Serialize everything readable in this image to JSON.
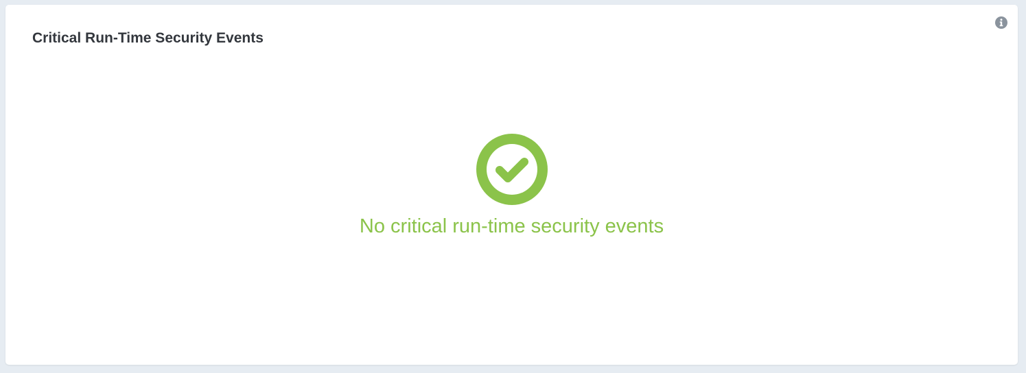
{
  "widget": {
    "title": "Critical Run-Time Security Events",
    "info_icon": "info-circle-icon",
    "empty_state": {
      "icon": "check-circle-icon",
      "message": "No critical run-time security events"
    }
  },
  "colors": {
    "success": "#8bc34a",
    "info_icon": "#8a939d",
    "title_text": "#33373d",
    "page_background": "#e6ecf2",
    "card_background": "#ffffff"
  }
}
